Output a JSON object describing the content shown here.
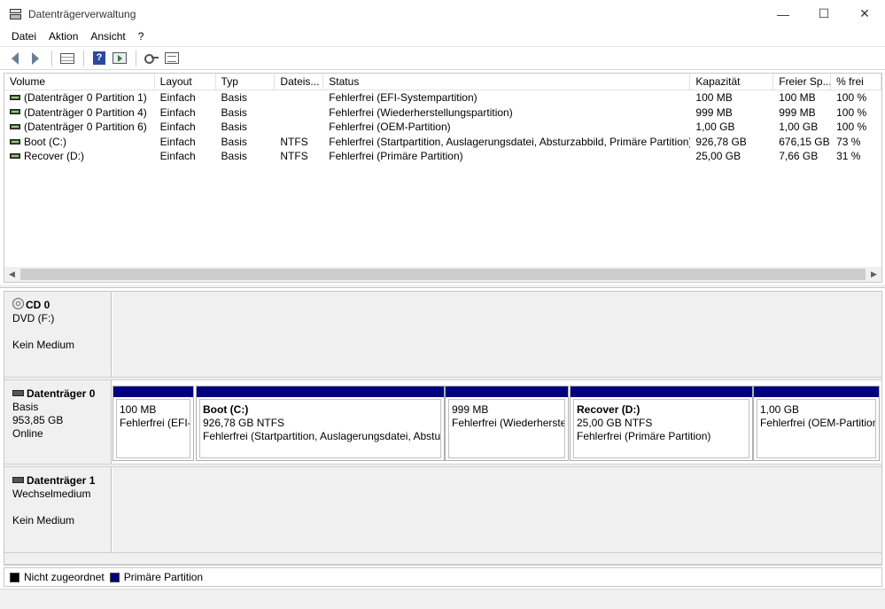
{
  "window": {
    "title": "Datenträgerverwaltung",
    "minimize_glyph": "—",
    "maximize_glyph": "☐",
    "close_glyph": "✕"
  },
  "menu": [
    "Datei",
    "Aktion",
    "Ansicht",
    "?"
  ],
  "toolbar": {
    "icons": [
      "back-arrow-icon",
      "forward-arrow-icon",
      "disk-list-icon",
      "help-icon",
      "action-pane-icon",
      "rescan-key-icon",
      "properties-icon"
    ]
  },
  "volume_list": {
    "columns": [
      "Volume",
      "Layout",
      "Typ",
      "Dateis...",
      "Status",
      "Kapazität",
      "Freier Sp...",
      "% frei"
    ],
    "rows": [
      [
        "(Datenträger 0 Partition 1)",
        "Einfach",
        "Basis",
        "",
        "Fehlerfrei (EFI-Systempartition)",
        "100 MB",
        "100 MB",
        "100 %"
      ],
      [
        "(Datenträger 0 Partition 4)",
        "Einfach",
        "Basis",
        "",
        "Fehlerfrei (Wiederherstellungspartition)",
        "999 MB",
        "999 MB",
        "100 %"
      ],
      [
        "(Datenträger 0 Partition 6)",
        "Einfach",
        "Basis",
        "",
        "Fehlerfrei (OEM-Partition)",
        "1,00 GB",
        "1,00 GB",
        "100 %"
      ],
      [
        "Boot (C:)",
        "Einfach",
        "Basis",
        "NTFS",
        "Fehlerfrei (Startpartition, Auslagerungsdatei, Absturzabbild, Primäre Partition)",
        "926,78 GB",
        "676,15 GB",
        "73 %"
      ],
      [
        "Recover (D:)",
        "Einfach",
        "Basis",
        "NTFS",
        "Fehlerfrei (Primäre Partition)",
        "25,00 GB",
        "7,66 GB",
        "31 %"
      ]
    ],
    "scroll_left": "◀",
    "scroll_right": "▶"
  },
  "disks": {
    "cd0": {
      "name": "CD 0",
      "line1": "DVD (F:)",
      "line2": "",
      "line3": "Kein Medium"
    },
    "disk0": {
      "name": "Datenträger 0",
      "line1": "Basis",
      "line2": "953,85 GB",
      "line3": "Online",
      "partitions": [
        {
          "title": "",
          "size": "100 MB",
          "status": "Fehlerfrei (EFI-Systempartition)"
        },
        {
          "title": "Boot  (C:)",
          "size": "926,78 GB NTFS",
          "status": "Fehlerfrei (Startpartition, Auslagerungsdatei, Absturzabbild, Primäre Partition)"
        },
        {
          "title": "",
          "size": "999 MB",
          "status": "Fehlerfrei (Wiederherstellungspartition)"
        },
        {
          "title": "Recover  (D:)",
          "size": "25,00 GB NTFS",
          "status": "Fehlerfrei (Primäre Partition)"
        },
        {
          "title": "",
          "size": "1,00 GB",
          "status": "Fehlerfrei (OEM-Partition)"
        }
      ]
    },
    "disk1": {
      "name": "Datenträger 1",
      "line1": "Wechselmedium",
      "line2": "",
      "line3": "Kein Medium"
    }
  },
  "legend": [
    {
      "label": "Nicht zugeordnet",
      "color": "#000000"
    },
    {
      "label": "Primäre Partition",
      "color": "#000080"
    }
  ]
}
